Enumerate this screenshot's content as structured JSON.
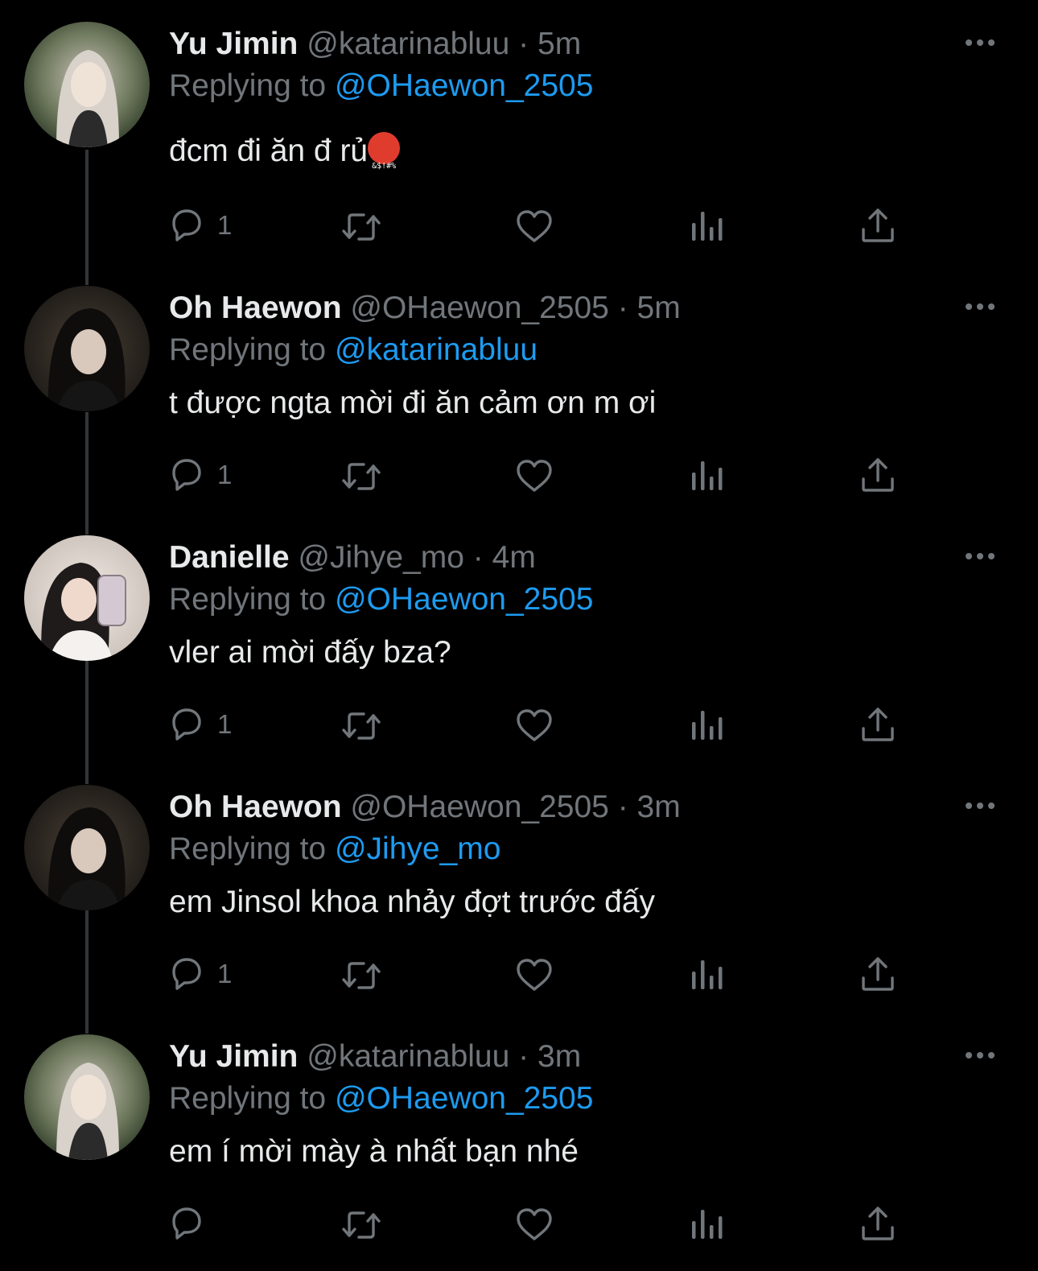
{
  "colors": {
    "background": "#000000",
    "text": "#e7e9ea",
    "muted": "#71767b",
    "accent": "#1d9bf0"
  },
  "reply_prefix": "Replying to",
  "tweets": [
    {
      "name": "Yu Jimin",
      "handle": "@katarinabluu",
      "dot": "·",
      "time": "5m",
      "reply_to": "@OHaewon_2505",
      "text": "đcm đi ăn đ rủ",
      "emoji": "&$!#%",
      "reply_count": "1",
      "avatar": "blonde-girl-avatar"
    },
    {
      "name": "Oh Haewon",
      "handle": "@OHaewon_2505",
      "dot": "·",
      "time": "5m",
      "reply_to": "@katarinabluu",
      "text": "t được ngta mời đi ăn cảm ơn m ơi",
      "reply_count": "1",
      "avatar": "dark-hair-girl-avatar"
    },
    {
      "name": "Danielle",
      "handle": "@Jihye_mo",
      "dot": "·",
      "time": "4m",
      "reply_to": "@OHaewon_2505",
      "text": "vler ai mời đấy bza?",
      "reply_count": "1",
      "avatar": "selfie-girl-avatar"
    },
    {
      "name": "Oh Haewon",
      "handle": "@OHaewon_2505",
      "dot": "·",
      "time": "3m",
      "reply_to": "@Jihye_mo",
      "text": "em Jinsol khoa nhảy đợt trước đấy",
      "reply_count": "1",
      "avatar": "dark-hair-girl-avatar"
    },
    {
      "name": "Yu Jimin",
      "handle": "@katarinabluu",
      "dot": "·",
      "time": "3m",
      "reply_to": "@OHaewon_2505",
      "text": "em í mời mày à nhất bạn nhé",
      "reply_count": "",
      "avatar": "blonde-girl-avatar"
    }
  ],
  "icons": {
    "reply": "reply-icon",
    "retweet": "retweet-icon",
    "like": "heart-icon",
    "views": "views-icon",
    "share": "share-icon",
    "more": "more-icon"
  }
}
